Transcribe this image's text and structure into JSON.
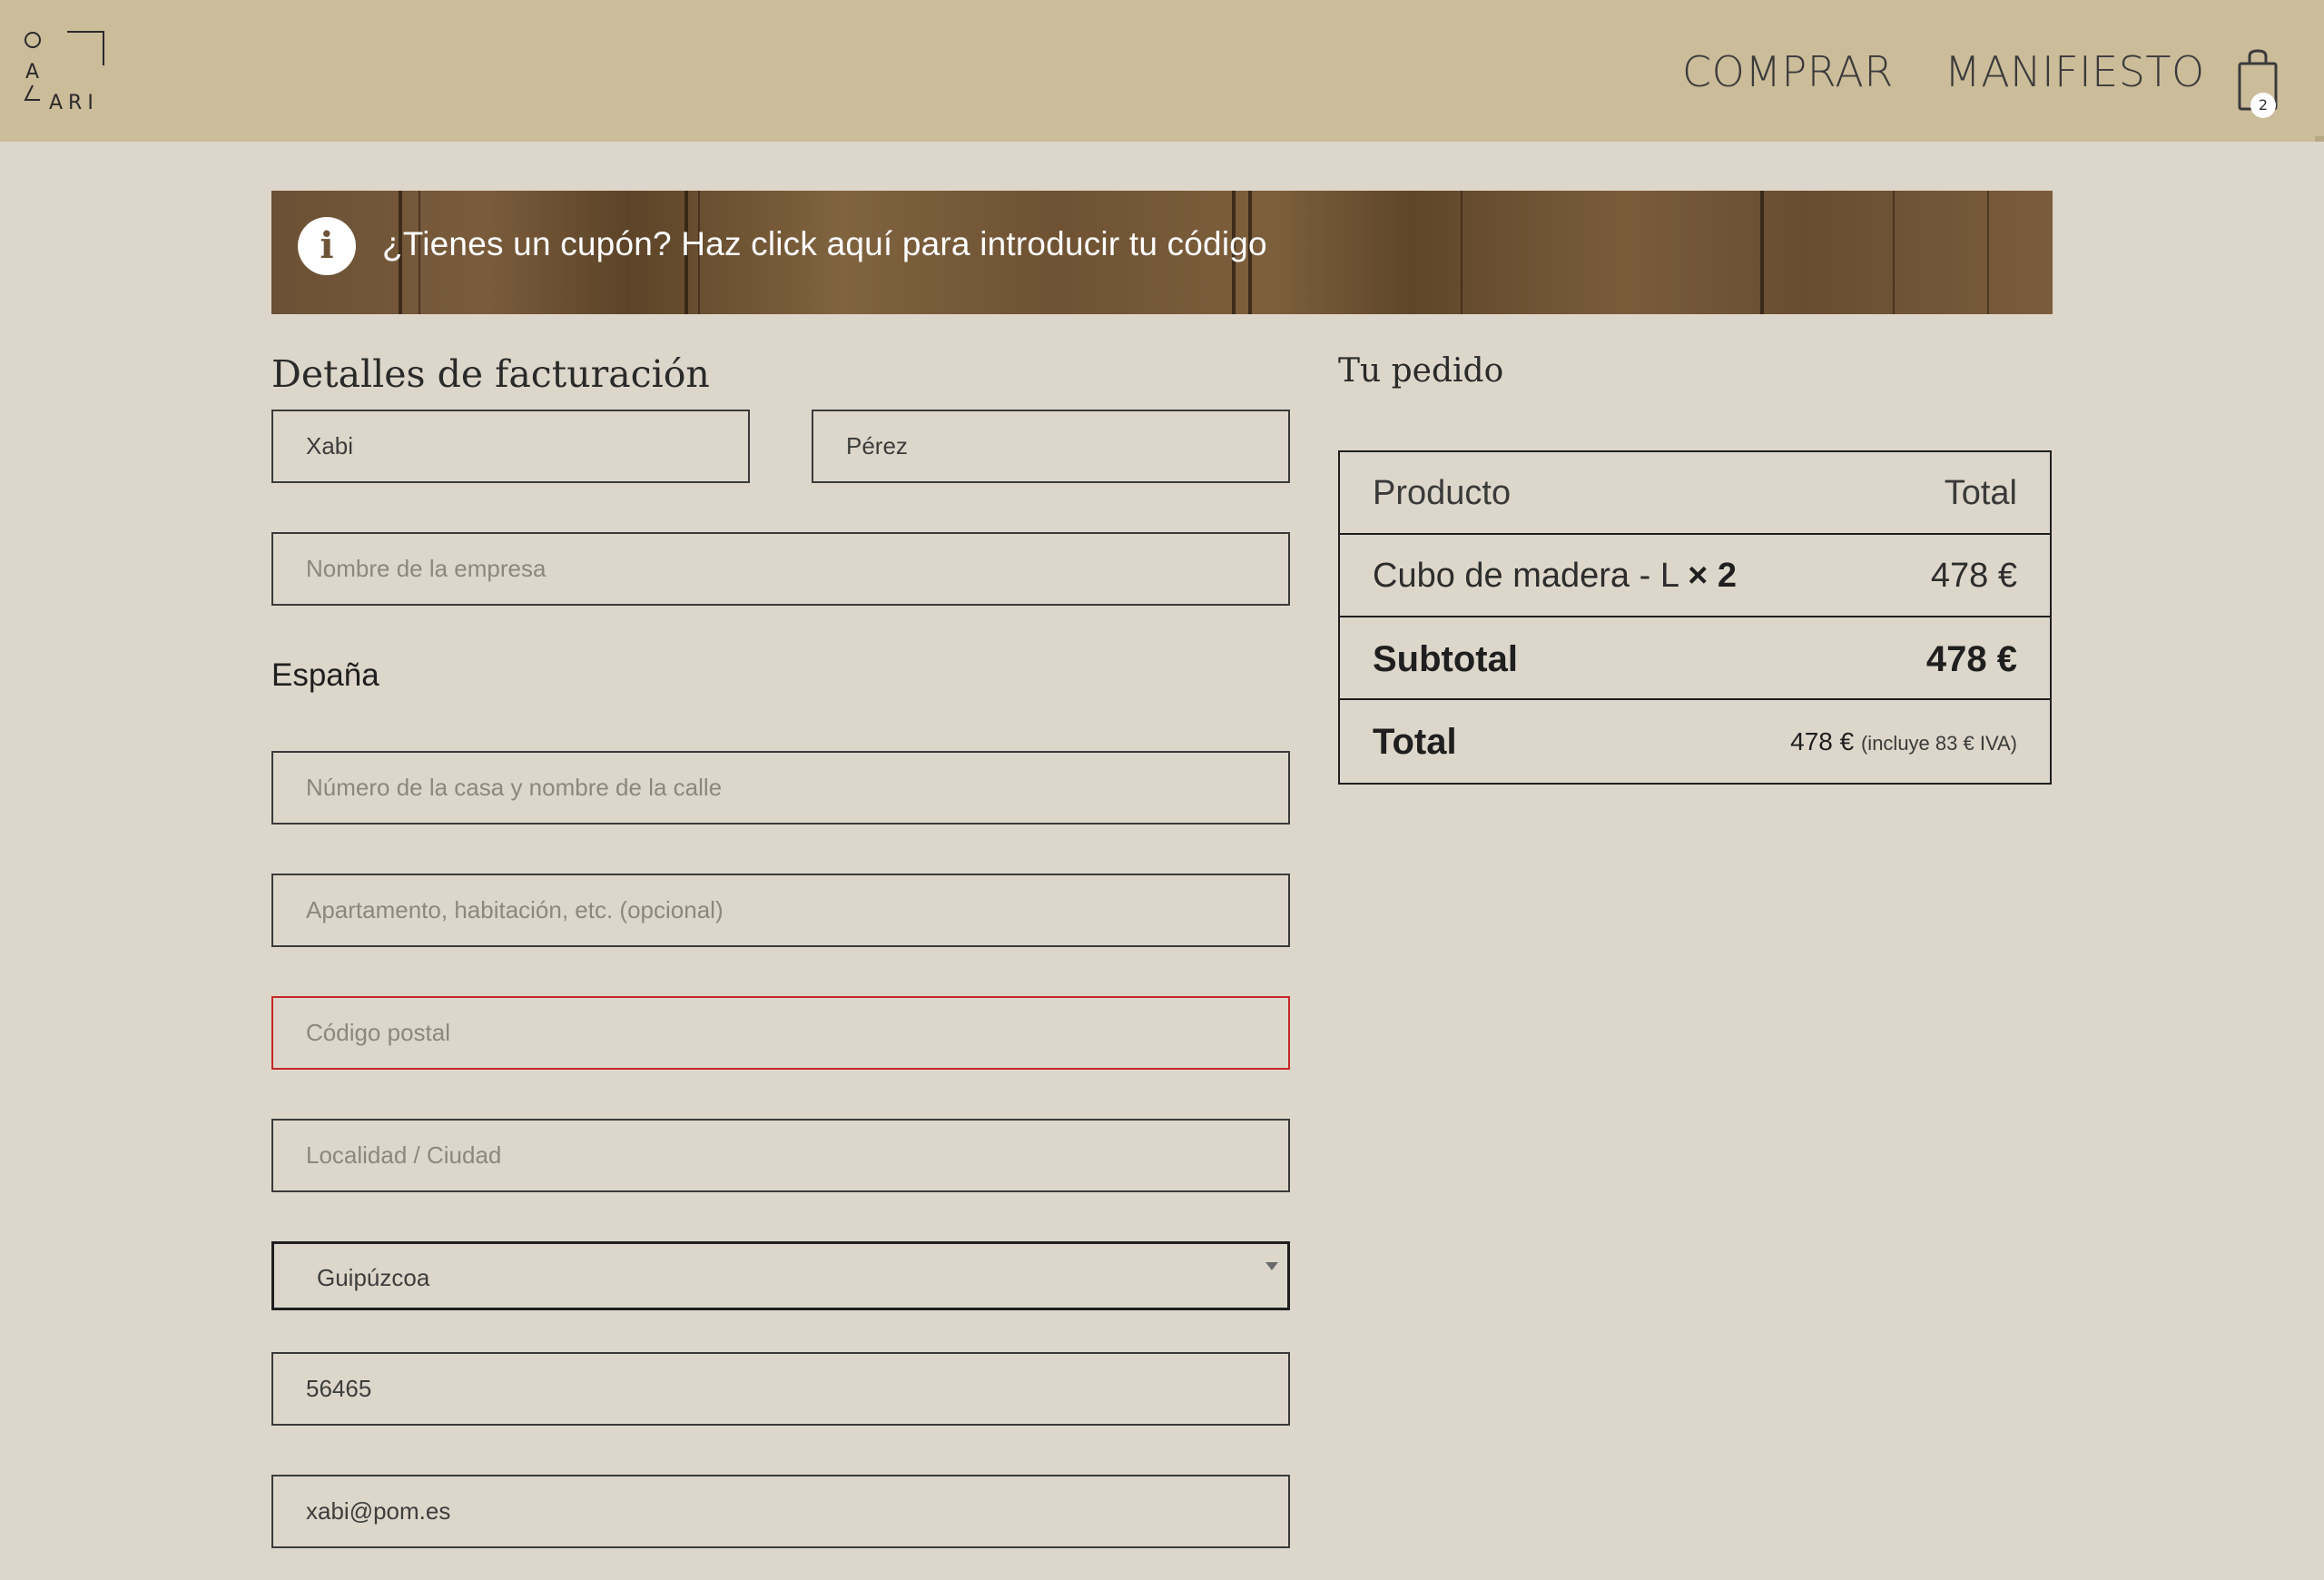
{
  "header": {
    "logo_letters": [
      "O",
      "A",
      "ARI"
    ],
    "nav": {
      "comprar": "COMPRAR",
      "manifiesto": "MANIFIESTO"
    },
    "cart": {
      "icon": "shopping-bag-icon",
      "count": "2"
    },
    "background_color": "#cbbc9a"
  },
  "banner": {
    "icon": "info-icon",
    "icon_glyph": "i",
    "text": "¿Tienes un cupón? Haz click aquí para introducir tu código"
  },
  "billing": {
    "title": "Detalles de facturación",
    "first_name": {
      "value": "Xabi"
    },
    "last_name": {
      "value": "Pérez"
    },
    "company": {
      "placeholder": "Nombre de la empresa"
    },
    "country": "España",
    "address_1": {
      "placeholder": "Número de la casa y nombre de la calle"
    },
    "address_2": {
      "placeholder": "Apartamento, habitación, etc. (opcional)"
    },
    "postcode": {
      "placeholder": "Código postal"
    },
    "city": {
      "placeholder": "Localidad / Ciudad"
    },
    "province": {
      "selected": "Guipúzcoa"
    },
    "phone": {
      "value": "56465"
    },
    "email": {
      "value": "xabi@pom.es"
    }
  },
  "order": {
    "title": "Tu pedido",
    "header": {
      "product": "Producto",
      "total": "Total"
    },
    "item": {
      "name": "Cubo de madera - L",
      "qty": "× 2",
      "price": "478 €"
    },
    "subtotal": {
      "label": "Subtotal",
      "value": "478 €"
    },
    "total": {
      "label": "Total",
      "value": "478 €",
      "note": "(incluye 83 € IVA)"
    }
  },
  "colors": {
    "page_bg": "#ddd7cb",
    "error_border": "#c62828",
    "text": "#2b2b2b"
  }
}
